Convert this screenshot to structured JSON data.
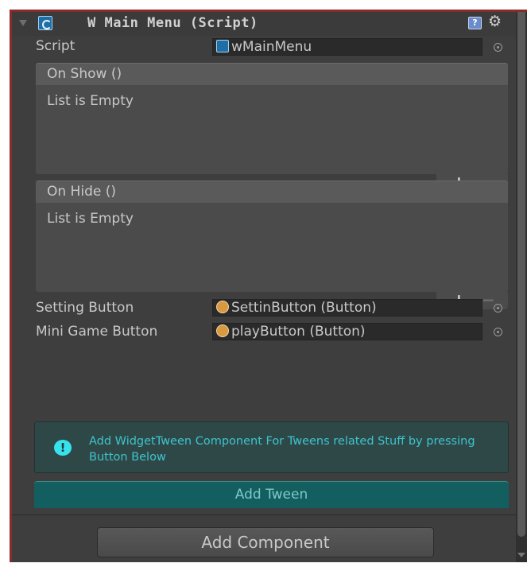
{
  "header": {
    "title": "W Main Menu (Script)",
    "help_icon": "help-book-icon",
    "settings_icon": "gear-icon"
  },
  "properties": {
    "script": {
      "label": "Script",
      "value": "wMainMenu",
      "icon": "script-icon"
    },
    "setting_button": {
      "label": "Setting Button",
      "value": "SettinButton (Button)",
      "icon": "button-object-icon"
    },
    "mini_game_button": {
      "label": "Mini Game Button",
      "value": "playButton (Button)",
      "icon": "button-object-icon"
    }
  },
  "events": [
    {
      "title": "On Show ()",
      "empty_text": "List is Empty",
      "add_label": "+",
      "remove_label": "−"
    },
    {
      "title": "On Hide ()",
      "empty_text": "List is Empty",
      "add_label": "+",
      "remove_label": "−"
    }
  ],
  "info": {
    "icon": "exclamation-icon",
    "icon_glyph": "!",
    "text": "Add WidgetTween Component For Tweens related Stuff by pressing Button Below"
  },
  "buttons": {
    "add_tween": "Add Tween",
    "add_component": "Add Component"
  },
  "colors": {
    "frame_border": "#8b2a2a",
    "panel_bg": "#3e3e3e",
    "info_text": "#3ec4cc",
    "tween_button": "#135f60"
  }
}
